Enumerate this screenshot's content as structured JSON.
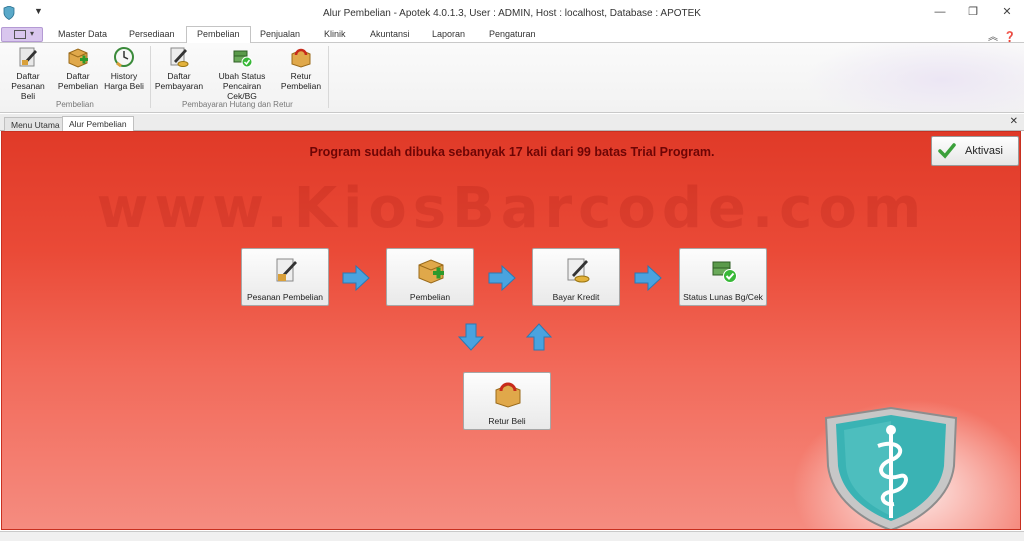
{
  "window": {
    "title": "Alur Pembelian - Apotek 4.0.1.3,  User : ADMIN, Host : localhost, Database : APOTEK",
    "quick_access_arrow": "▼",
    "minimize": "—",
    "restore": "❐",
    "close": "✕"
  },
  "ribbon_tabs": [
    "Master Data",
    "Persediaan",
    "Pembelian",
    "Penjualan",
    "Klinik",
    "Akuntansi",
    "Laporan",
    "Pengaturan"
  ],
  "active_ribbon_tab": "Pembelian",
  "ribbon": {
    "groups": [
      {
        "label": "Pembelian",
        "buttons": [
          {
            "line1": "Daftar",
            "line2": "Pesanan Beli",
            "icon": "pen-document-icon"
          },
          {
            "line1": "Daftar",
            "line2": "Pembelian",
            "icon": "box-add-icon"
          },
          {
            "line1": "History",
            "line2": "Harga Beli",
            "icon": "clock-icon"
          }
        ]
      },
      {
        "label": "Pembayaran Hutang dan Retur",
        "buttons": [
          {
            "line1": "Daftar",
            "line2": "Pembayaran",
            "icon": "pen-coins-icon"
          },
          {
            "line1": "Ubah Status",
            "line2": "Pencairan Cek/BG",
            "icon": "money-check-icon"
          },
          {
            "line1": "Retur",
            "line2": "Pembelian",
            "icon": "return-box-icon"
          }
        ]
      }
    ]
  },
  "doc_tabs": [
    "Menu Utama",
    "Alur Pembelian"
  ],
  "active_doc_tab": "Alur Pembelian",
  "doc_close": "✕",
  "main": {
    "trial_message": "Program sudah dibuka sebanyak 17 kali dari 99 batas Trial Program.",
    "watermark": "www.KiosBarcode.com",
    "aktivasi_label": "Aktivasi",
    "flow": {
      "pesanan": "Pesanan Pembelian",
      "pembelian": "Pembelian",
      "bayar": "Bayar Kredit",
      "status": "Status Lunas Bg/Cek",
      "retur": "Retur Beli"
    }
  },
  "colors": {
    "panel_top": "#e03a28",
    "panel_bottom": "#f58c80",
    "arrow": "#4aa3df",
    "trial_text": "#6d0505",
    "shield": "#3ab3b4"
  }
}
